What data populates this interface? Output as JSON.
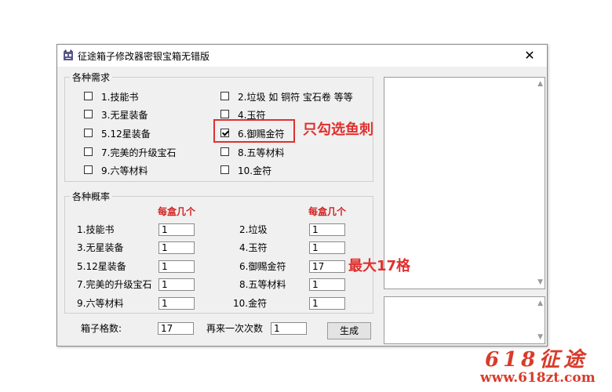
{
  "window": {
    "title": "征途箱子修改器密银宝箱无错版",
    "close_glyph": "✕"
  },
  "needs_group": {
    "title": "各种需求",
    "items": [
      {
        "label": "1.技能书",
        "checked": false
      },
      {
        "label": "2.垃圾 如 铜符 宝石卷 等等",
        "checked": false
      },
      {
        "label": "3.无星装备",
        "checked": false
      },
      {
        "label": "4.玉符",
        "checked": false
      },
      {
        "label": "5.12星装备",
        "checked": false
      },
      {
        "label": "6.御赐金符",
        "checked": true
      },
      {
        "label": "7.完美的升级宝石",
        "checked": false
      },
      {
        "label": "8.五等材料",
        "checked": false
      },
      {
        "label": "9.六等材料",
        "checked": false
      },
      {
        "label": "10.金符",
        "checked": false
      }
    ]
  },
  "prob_group": {
    "title": "各种概率",
    "col_header": "每盒几个",
    "rows": [
      {
        "label": "1.技能书",
        "value": "1"
      },
      {
        "label": "2.垃圾",
        "value": "1"
      },
      {
        "label": "3.无星装备",
        "value": "1"
      },
      {
        "label": "4.玉符",
        "value": "1"
      },
      {
        "label": "5.12星装备",
        "value": "1"
      },
      {
        "label": "6.御赐金符",
        "value": "17"
      },
      {
        "label": "7.完美的升级宝石",
        "value": "1"
      },
      {
        "label": "8.五等材料",
        "value": "1"
      },
      {
        "label": "9.六等材料",
        "value": "1"
      },
      {
        "label": "10.金符",
        "value": "1"
      }
    ]
  },
  "footer": {
    "box_count_label": "箱子格数:",
    "box_count_value": "17",
    "repeat_label": "再来一次次数",
    "repeat_value": "1",
    "generate_label": "生成"
  },
  "annotations": {
    "only_check": "只勾选鱼刺",
    "max_cells": "最大17格"
  },
  "brand": {
    "logo": "618征途",
    "url": "www.618zt.com"
  },
  "colors": {
    "accent_red": "#d21f1f",
    "annotation_red": "#e0302e"
  }
}
